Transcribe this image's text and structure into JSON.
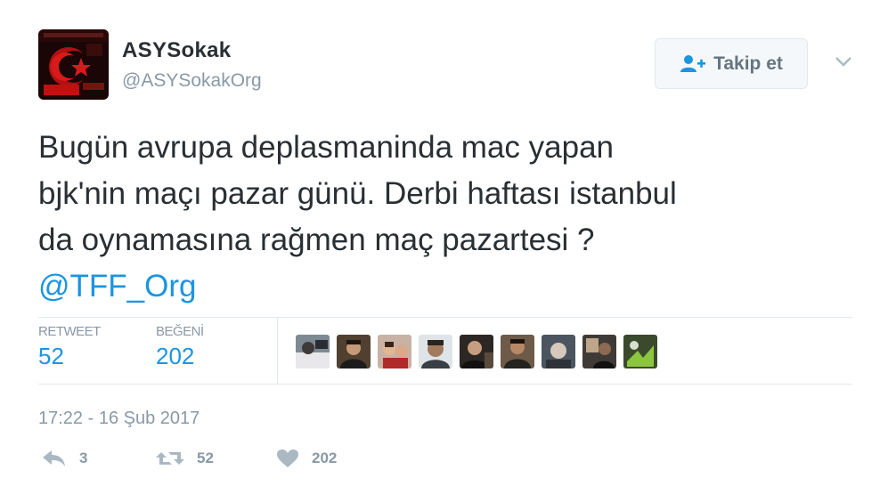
{
  "account": {
    "display_name": "ASYSokak",
    "handle": "@ASYSokakOrg",
    "avatar_icon": "ultras-logo-avatar"
  },
  "follow_button": {
    "label": "Takip et",
    "icon": "follow-user-plus-icon"
  },
  "menu": {
    "icon": "chevron-down-icon"
  },
  "tweet": {
    "lines": [
      "Bugün avrupa deplasmaninda mac yapan",
      "bjk'nin maçı pazar günü. Derbi haftası istanbul",
      "da oynamasına rağmen maç pazartesi ?"
    ],
    "mention": "@TFF_Org"
  },
  "stats": {
    "retweets": {
      "label": "RETWEET",
      "value": "52"
    },
    "likes": {
      "label": "BEĞENİ",
      "value": "202"
    }
  },
  "likers_count_shown": 9,
  "timestamp": "17:22 - 16 Şub 2017",
  "actions": {
    "reply": {
      "icon": "reply-icon",
      "count": "3"
    },
    "retweet": {
      "icon": "retweet-icon",
      "count": "52"
    },
    "like": {
      "icon": "heart-icon",
      "count": "202"
    }
  },
  "colors": {
    "link": "#1b95e0",
    "muted": "#8899a6",
    "text": "#292f33",
    "divider": "#e1e8ed"
  }
}
